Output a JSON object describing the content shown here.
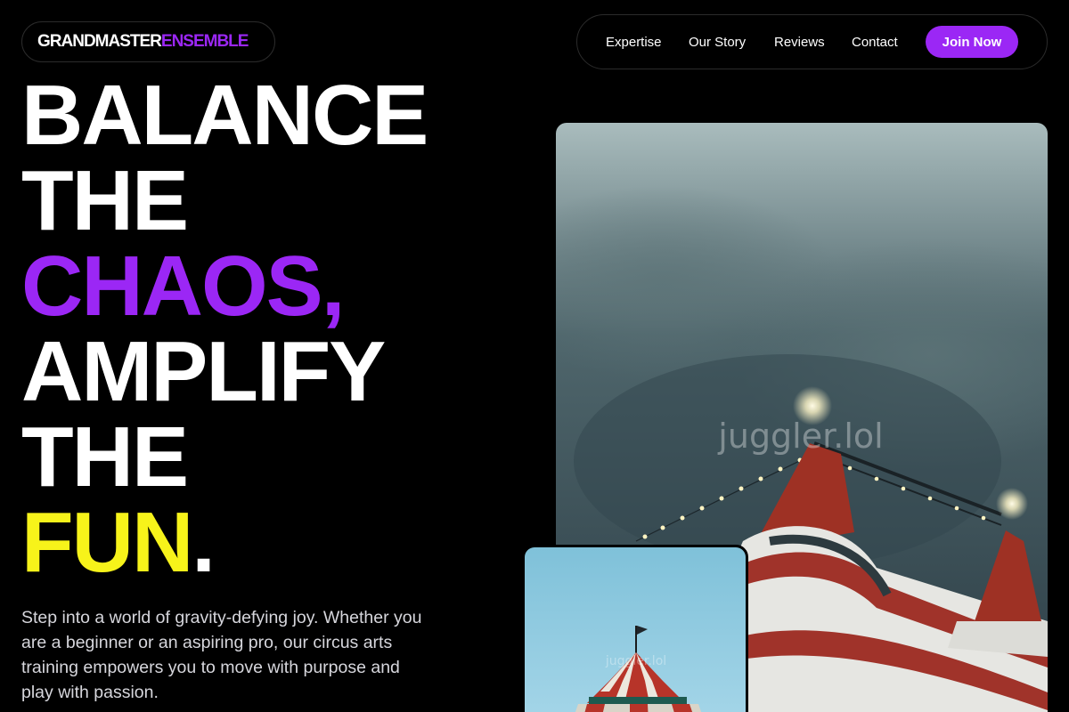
{
  "brand": {
    "part1": "GRANDMASTER",
    "part2": "ENSEMBLE"
  },
  "nav": {
    "links": [
      "Expertise",
      "Our Story",
      "Reviews",
      "Contact"
    ],
    "cta": "Join Now"
  },
  "hero": {
    "lines": [
      "BALANCE",
      "THE",
      "CHAOS,",
      "AMPLIFY",
      "THE",
      "FUN",
      "."
    ],
    "tagline": "Step into a world of gravity-defying joy. Whether you are a beginner or an aspiring pro, our circus arts training empowers you to move with purpose and play with passion."
  },
  "images": {
    "main_watermark": "juggler.lol",
    "small_watermark": "juggler.lol"
  },
  "colors": {
    "accent_purple": "#9b27f5",
    "accent_yellow": "#f7f31a",
    "background": "#000000"
  }
}
